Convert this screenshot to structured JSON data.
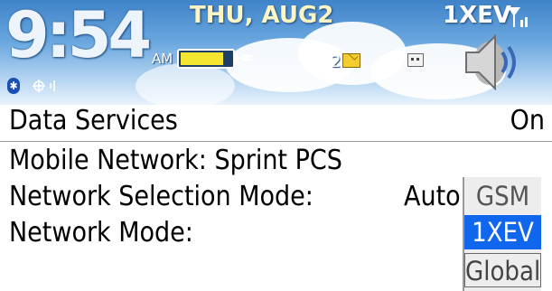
{
  "status_bar": {
    "time": "9:54",
    "ampm": "AM",
    "date": "THU, AUG2",
    "network_type": "1XEV",
    "battery_level": 0.85,
    "unread_messages": "2",
    "icons": [
      "bluetooth-icon",
      "gps-icon",
      "battery-icon",
      "charging-plug-icon",
      "envelope-icon",
      "sim-card-icon",
      "signal-icon",
      "speaker-icon"
    ],
    "colors": {
      "sky_top": "#3f83c8",
      "sky_bottom": "#e9f3fc",
      "battery_fill": "#f4e62e"
    }
  },
  "options": {
    "data_services": {
      "label": "Data Services",
      "value": "On"
    },
    "mobile_network": {
      "label": "Mobile Network: Sprint PCS"
    },
    "network_selection_mode": {
      "label": "Network Selection Mode:",
      "value": "Auto"
    },
    "network_mode": {
      "label": "Network Mode:"
    }
  },
  "dropdown": {
    "options": [
      "GSM",
      "1XEV",
      "Global"
    ],
    "selected": "1XEV",
    "highlight_color": "#1166ee"
  }
}
